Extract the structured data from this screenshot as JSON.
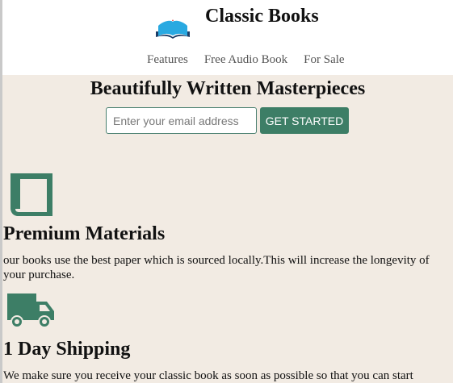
{
  "header": {
    "brand": "Classic Books",
    "logo_icon": "open-book-icon",
    "nav": [
      "Features",
      "Free Audio Book",
      "For Sale"
    ]
  },
  "hero": {
    "title": "Beautifully Written Masterpieces",
    "email_placeholder": "Enter your email address",
    "button_label": "GET STARTED"
  },
  "features": [
    {
      "icon": "book-icon",
      "title": "Premium Materials",
      "text": "our books use the best paper which is sourced locally.This will increase the longevity of your purchase."
    },
    {
      "icon": "truck-icon",
      "title": "1 Day Shipping",
      "text": "We make sure you receive your classic book as soon as possible so that you can start"
    }
  ],
  "colors": {
    "page_background": "#f2ebe3",
    "header_background": "#ffffff",
    "accent": "#3d7e66",
    "logo_blue": "#29a9e1"
  }
}
